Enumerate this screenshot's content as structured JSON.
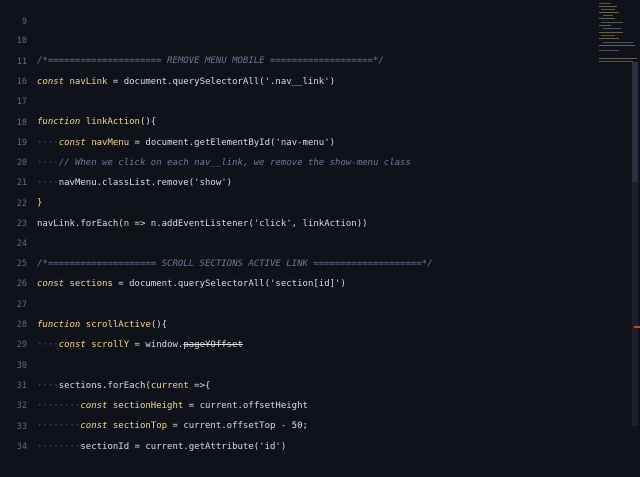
{
  "line_numbers": [
    "9",
    "10",
    "11",
    "16",
    "17",
    "18",
    "19",
    "20",
    "21",
    "22",
    "23",
    "24",
    "25",
    "26",
    "27",
    "28",
    "29",
    "30",
    "31",
    "32",
    "33",
    "34"
  ],
  "lines": {
    "l10_comment": "/*===================== REMOVE MENU MOBILE ===================*/",
    "l11_a": "const",
    "l11_b": " navLink",
    "l11_c": " = document.querySelectorAll('.nav__link')",
    "l16_a": "function",
    "l16_b": " linkAction",
    "l16_c": "(){",
    "l18_a": "const",
    "l18_b": " navMenu",
    "l18_c": " = document.getElementById('nav-menu')",
    "l19_comment": "// When we click on each nav__link, we remove the show-menu class",
    "l20": "navMenu.classList.remove('show')",
    "l21": "}",
    "l22_a": "navLink.forEach(",
    "l22_b": "n",
    "l22_c": " => n.addEventListener('click', linkAction))",
    "l24_comment": "/*==================== SCROLL SECTIONS ACTIVE LINK ====================*/",
    "l25_a": "const",
    "l25_b": " sections",
    "l25_c": " = document.querySelectorAll('section[id]')",
    "l27_a": "function",
    "l27_b": " scrollActive",
    "l27_c": "(){",
    "l28_a": "const",
    "l28_b": " scrollY",
    "l28_c": " = window.",
    "l28_d": "pageYOffset",
    "l30_a": "sections.forEach(",
    "l30_b": "current",
    "l30_c": " =>{",
    "l31_a": "const",
    "l31_b": " sectionHeight",
    "l31_c": " = current.offsetHeight",
    "l32_a": "const",
    "l32_b": " sectionTop",
    "l32_c": " = current.offsetTop - 50;",
    "l33": "sectionId = current.getAttribute('id')"
  },
  "colors": {
    "background": "#0f1219",
    "keyword": "#f5d58a",
    "text": "#d9dce3",
    "comment": "#6b7894",
    "line_number": "#5f6b82",
    "scroll_marker": "#d23a3a"
  }
}
